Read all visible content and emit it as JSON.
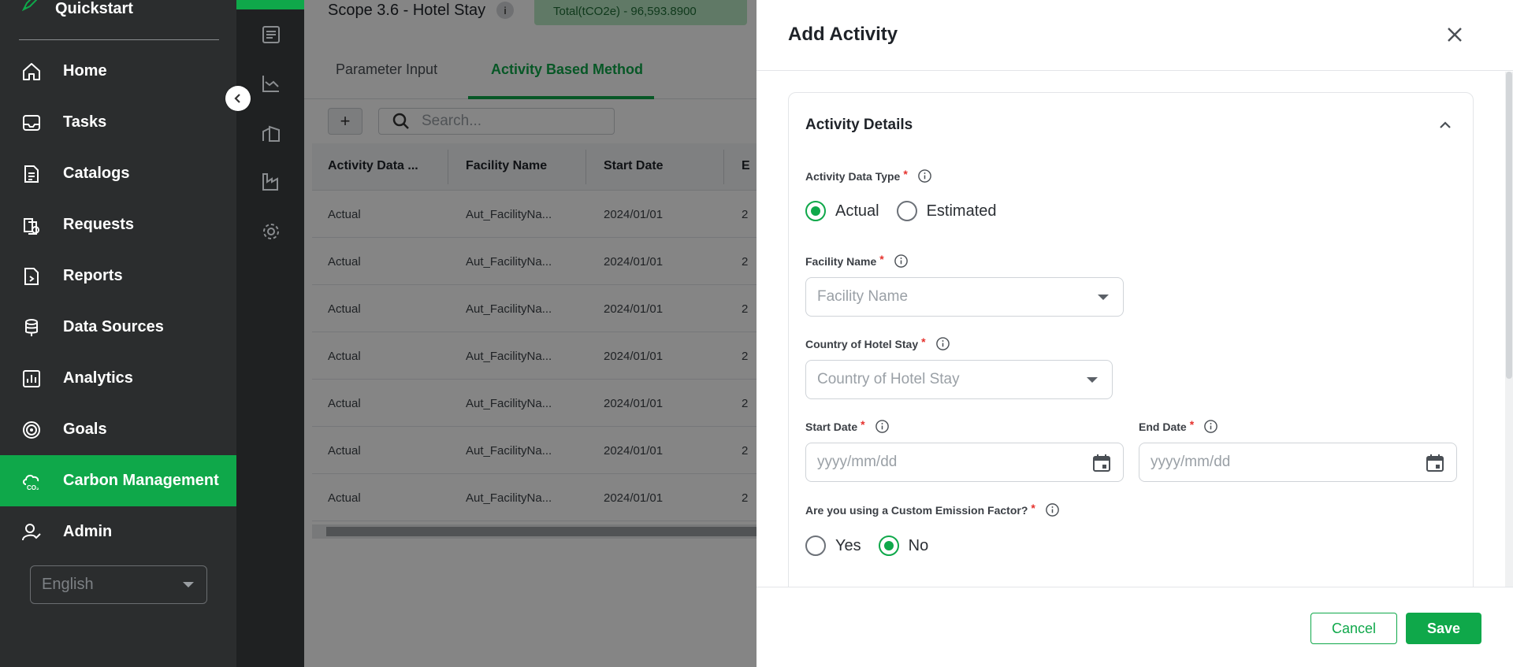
{
  "sidebar": {
    "quickstart_label": "Quickstart",
    "items": [
      {
        "label": "Home",
        "icon": "home-icon"
      },
      {
        "label": "Tasks",
        "icon": "inbox-icon"
      },
      {
        "label": "Catalogs",
        "icon": "catalog-icon"
      },
      {
        "label": "Requests",
        "icon": "requests-icon"
      },
      {
        "label": "Reports",
        "icon": "reports-icon"
      },
      {
        "label": "Data Sources",
        "icon": "database-icon"
      },
      {
        "label": "Analytics",
        "icon": "analytics-icon"
      },
      {
        "label": "Goals",
        "icon": "target-icon"
      },
      {
        "label": "Carbon Management",
        "icon": "carbon-cloud-icon",
        "active": true
      },
      {
        "label": "Admin",
        "icon": "admin-user-icon"
      }
    ],
    "language": "English",
    "accent_color": "#0fa84a"
  },
  "main": {
    "scope_title": "Scope 3.6 - Hotel Stay",
    "info_badge": "i",
    "total": "Total(tCO2e) - 96,593.8900",
    "tabs": [
      {
        "label": "Parameter Input",
        "active": false
      },
      {
        "label": "Activity Based Method",
        "active": true
      }
    ],
    "add_label": "+",
    "search_placeholder": "Search...",
    "table": {
      "columns": [
        "Activity Data ...",
        "Facility Name",
        "Start Date",
        "E"
      ],
      "rows": [
        [
          "Actual",
          "Aut_FacilityNa...",
          "2024/01/01",
          "2"
        ],
        [
          "Actual",
          "Aut_FacilityNa...",
          "2024/01/01",
          "2"
        ],
        [
          "Actual",
          "Aut_FacilityNa...",
          "2024/01/01",
          "2"
        ],
        [
          "Actual",
          "Aut_FacilityNa...",
          "2024/01/01",
          "2"
        ],
        [
          "Actual",
          "Aut_FacilityNa...",
          "2024/01/01",
          "2"
        ],
        [
          "Actual",
          "Aut_FacilityNa...",
          "2024/01/01",
          "2"
        ],
        [
          "Actual",
          "Aut_FacilityNa...",
          "2024/01/01",
          "2"
        ]
      ]
    }
  },
  "drawer": {
    "title": "Add Activity",
    "section_title": "Activity Details",
    "activity_type": {
      "label": "Activity Data Type",
      "options": [
        "Actual",
        "Estimated"
      ],
      "selected": "Actual"
    },
    "facility": {
      "label": "Facility Name",
      "placeholder": "Facility Name"
    },
    "country": {
      "label": "Country of Hotel Stay",
      "placeholder": "Country of Hotel Stay"
    },
    "start_date": {
      "label": "Start Date",
      "placeholder": "yyyy/mm/dd"
    },
    "end_date": {
      "label": "End Date",
      "placeholder": "yyyy/mm/dd"
    },
    "custom_factor": {
      "label": "Are you using a Custom Emission Factor?",
      "options": [
        "Yes",
        "No"
      ],
      "selected": "No"
    },
    "required_mark": "*",
    "cancel_label": "Cancel",
    "save_label": "Save"
  }
}
